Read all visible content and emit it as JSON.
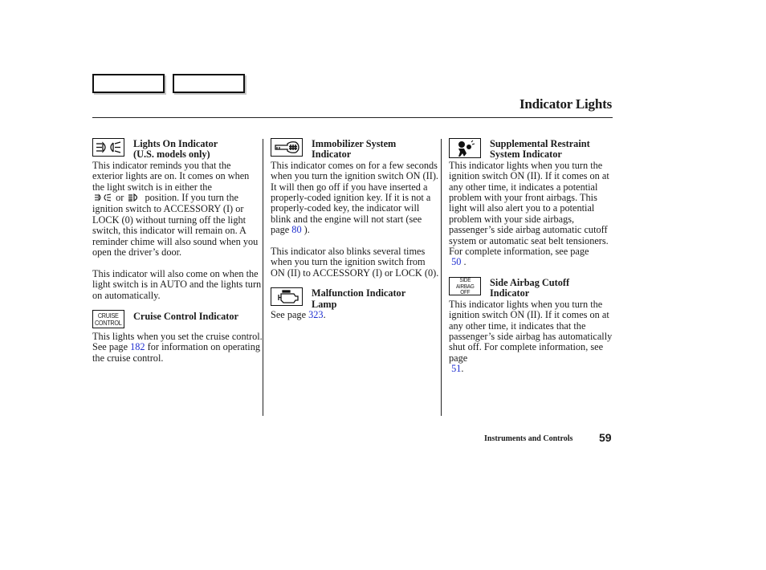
{
  "header": {
    "title": "Indicator Lights",
    "tabs": [
      {
        "label": ""
      },
      {
        "label": ""
      }
    ]
  },
  "columns": [
    {
      "sections": [
        {
          "icon": "headlight-icon",
          "title_lines": [
            "Lights On Indicator",
            "(U.S. models only)"
          ],
          "body": {
            "p1_a": "This indicator reminds you that the exterior lights are on. It comes on when the light switch is in either the",
            "p1_or": "or",
            "p1_b": "position. If you turn the ignition switch to ACCESSORY (I) or LOCK (0) without turning off the light switch, this indicator will remain on. A reminder chime will also sound when you open the driver’s door.",
            "p2": "This indicator will also come on when the light switch is in AUTO and the lights turn on automatically."
          }
        },
        {
          "icon": "cruise-control-icon",
          "icon_text_lines": [
            "CRUISE",
            "CONTROL"
          ],
          "title_lines": [
            "Cruise Control Indicator"
          ],
          "body": {
            "pre": "This lights when you set the cruise control. See page",
            "page_link": "182",
            "post": "for information on operating the cruise control."
          }
        }
      ]
    },
    {
      "sections": [
        {
          "icon": "immobilizer-key-icon",
          "title_lines": [
            "Immobilizer System",
            "Indicator"
          ],
          "body": {
            "pre": "This indicator comes on for a few seconds when you turn the ignition switch ON (II). It will then go off if you have inserted a properly-coded ignition key. If it is not a properly-coded key, the indicator will blink and the engine will not start (see page",
            "page_link": "80",
            "post": ").",
            "p2": "This indicator also blinks several times when you turn the ignition switch from ON (II) to ACCESSORY (I) or LOCK (0)."
          }
        },
        {
          "icon": "engine-icon",
          "title_lines": [
            "Malfunction Indicator",
            "Lamp"
          ],
          "body": {
            "pre": "See page",
            "page_link": "323",
            "post": "."
          }
        }
      ]
    },
    {
      "sections": [
        {
          "icon": "airbag-icon",
          "title_lines": [
            "Supplemental Restraint",
            "System Indicator"
          ],
          "body": {
            "pre": "This indicator lights when you turn the ignition switch ON (II). If it comes on at any other time, it indicates a potential problem with your front airbags. This light will also alert you to a potential problem with your side airbags, passenger’s side airbag automatic cutoff system or automatic seat belt tensioners. For complete information, see page",
            "page_link": "50",
            "post": "."
          }
        },
        {
          "icon": "side-airbag-off-icon",
          "icon_text_lines": [
            "SIDE",
            "AIRBAG",
            "OFF"
          ],
          "title_lines": [
            "Side Airbag Cutoff",
            "Indicator"
          ],
          "body": {
            "pre": "This indicator lights when you turn the ignition switch ON (II). If it comes on at any other time, it indicates that the passenger’s side airbag has automatically shut off. For complete information, see page",
            "page_link": "51",
            "post": "."
          }
        }
      ]
    }
  ],
  "footer": {
    "section": "Instruments and Controls",
    "page_number": "59"
  },
  "colors": {
    "link": "#1f2fd0",
    "text": "#1a1a1a"
  }
}
